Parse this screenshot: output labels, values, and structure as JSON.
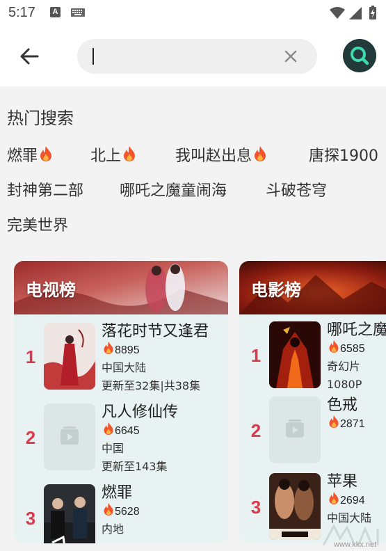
{
  "status_bar": {
    "time": "5:17"
  },
  "search": {
    "placeholder": "",
    "value": ""
  },
  "hot_search": {
    "title": "热门搜索",
    "tags": [
      {
        "label": "燃罪",
        "hot": true
      },
      {
        "label": "北上",
        "hot": true
      },
      {
        "label": "我叫赵出息",
        "hot": true
      },
      {
        "label": "唐探1900",
        "hot": false
      },
      {
        "label": "封神第二部",
        "hot": false
      },
      {
        "label": "哪吒之魔童闹海",
        "hot": false
      },
      {
        "label": "斗破苍穹",
        "hot": false
      },
      {
        "label": "完美世界",
        "hot": false
      }
    ]
  },
  "tv_rank": {
    "title": "电视榜",
    "items": [
      {
        "rank": "1",
        "title": "落花时节又逢君",
        "heat": "8895",
        "line1": "中国大陆",
        "line2": "更新至32集|共38集"
      },
      {
        "rank": "2",
        "title": "凡人修仙传",
        "heat": "6645",
        "line1": "中国",
        "line2": "更新至143集"
      },
      {
        "rank": "3",
        "title": "燃罪",
        "heat": "5628",
        "line1": "内地",
        "line2": ""
      }
    ]
  },
  "movie_rank": {
    "title": "电影榜",
    "items": [
      {
        "rank": "1",
        "title": "哪吒之魔童闹海",
        "heat": "6585",
        "line1": "奇幻片",
        "line2": "1080P"
      },
      {
        "rank": "2",
        "title": "色戒",
        "heat": "2871",
        "line1": "",
        "line2": ""
      },
      {
        "rank": "3",
        "title": "苹果",
        "heat": "2694",
        "line1": "中国大陆",
        "line2": ""
      }
    ]
  },
  "colors": {
    "rank": "#d83a4e",
    "flame": "#f2552c",
    "search_button": "#233a3a",
    "card_bg": "#e8f2f2"
  },
  "watermark": "www.kkx.net"
}
